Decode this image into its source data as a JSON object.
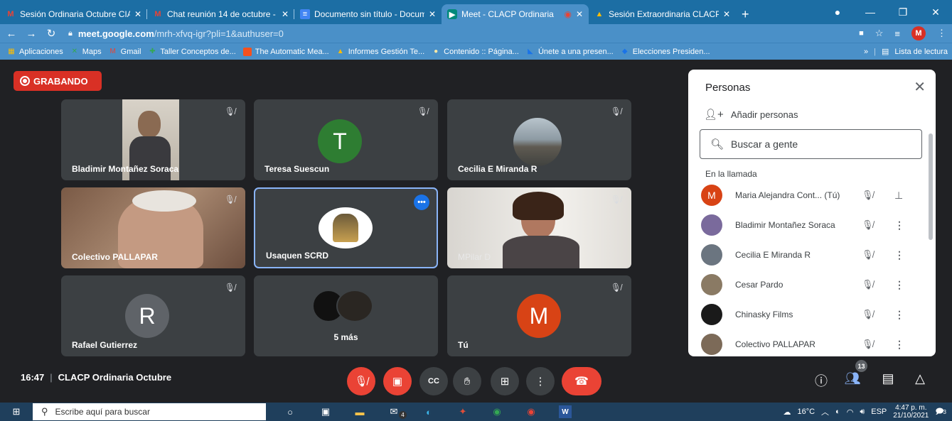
{
  "browser": {
    "tabs": [
      {
        "icon": "gmail-icon",
        "title": "Sesión Ordinaria Octubre CIA"
      },
      {
        "icon": "gmail-icon",
        "title": "Chat reunión 14 de octubre -"
      },
      {
        "icon": "docs-icon",
        "title": "Documento sin título - Docum"
      },
      {
        "icon": "meet-icon",
        "title": "Meet - CLACP Ordinaria"
      },
      {
        "icon": "drive-icon",
        "title": "Sesión Extraordinaria CLACP"
      }
    ],
    "url_host": "meet.google.com",
    "url_path": "/mrh-xfvq-igr?pli=1&authuser=0",
    "profile_initial": "M",
    "bookmarks": [
      {
        "icon": "apps-icon",
        "label": "Aplicaciones"
      },
      {
        "icon": "maps-icon",
        "label": "Maps"
      },
      {
        "icon": "gmail-icon",
        "label": "Gmail"
      },
      {
        "icon": "bookmark-icon",
        "label": "Taller Conceptos de..."
      },
      {
        "icon": "bookmark-icon",
        "label": "The Automatic Mea..."
      },
      {
        "icon": "drive-icon",
        "label": "Informes Gestión Te..."
      },
      {
        "icon": "bookmark-icon",
        "label": "Contenido :: Página..."
      },
      {
        "icon": "bookmark-icon",
        "label": "Únete a una presen..."
      },
      {
        "icon": "bookmark-icon",
        "label": "Elecciones Presiden..."
      }
    ],
    "reading_list": "Lista de lectura",
    "overflow": "»"
  },
  "meet": {
    "recording_label": "GRABANDO",
    "tiles": [
      {
        "name": "Bladimir Montañez Soraca",
        "type": "video"
      },
      {
        "name": "Teresa Suescun",
        "type": "letter",
        "letter": "T",
        "color": "#2e7d32"
      },
      {
        "name": "Cecilia E Miranda R",
        "type": "photo"
      },
      {
        "name": "Colectivo PALLAPAR",
        "type": "video"
      },
      {
        "name": "Usaquen SCRD",
        "type": "logo"
      },
      {
        "name": "MPilar D",
        "type": "video"
      },
      {
        "name": "Rafael Gutierrez",
        "type": "letter",
        "letter": "R",
        "color": "#5f6368"
      },
      {
        "name": "5 más",
        "type": "group"
      },
      {
        "name": "Tú",
        "type": "letter",
        "letter": "M",
        "color": "#d84315"
      }
    ],
    "time": "16:47",
    "meeting_name": "CLACP Ordinaria Octubre",
    "participant_count": "13"
  },
  "people": {
    "title": "Personas",
    "add_label": "Añadir personas",
    "search_placeholder": "Buscar a gente",
    "section_label": "En la llamada",
    "list": [
      {
        "name": "Maria Alejandra Cont... (Tú)",
        "avatar_letter": "M",
        "avatar_color": "#d84315",
        "action": "pin-icon"
      },
      {
        "name": "Bladimir Montañez Soraca",
        "avatar_letter": "",
        "avatar_color": "#7a6a9c",
        "action": "more-vert-icon"
      },
      {
        "name": "Cecilia E Miranda R",
        "avatar_letter": "",
        "avatar_color": "#6b7580",
        "action": "more-vert-icon"
      },
      {
        "name": "Cesar Pardo",
        "avatar_letter": "",
        "avatar_color": "#8a7a64",
        "action": "more-vert-icon"
      },
      {
        "name": "Chinasky Films",
        "avatar_letter": "",
        "avatar_color": "#1a1a1a",
        "action": "more-vert-icon"
      },
      {
        "name": "Colectivo PALLAPAR",
        "avatar_letter": "",
        "avatar_color": "#7c6a58",
        "action": "more-vert-icon"
      }
    ]
  },
  "taskbar": {
    "search_placeholder": "Escribe aquí para buscar",
    "weather": "16°C",
    "language": "ESP",
    "clock_time": "4:47 p. m.",
    "clock_date": "21/10/2021",
    "notifications": "3",
    "mail_badge": "4"
  }
}
